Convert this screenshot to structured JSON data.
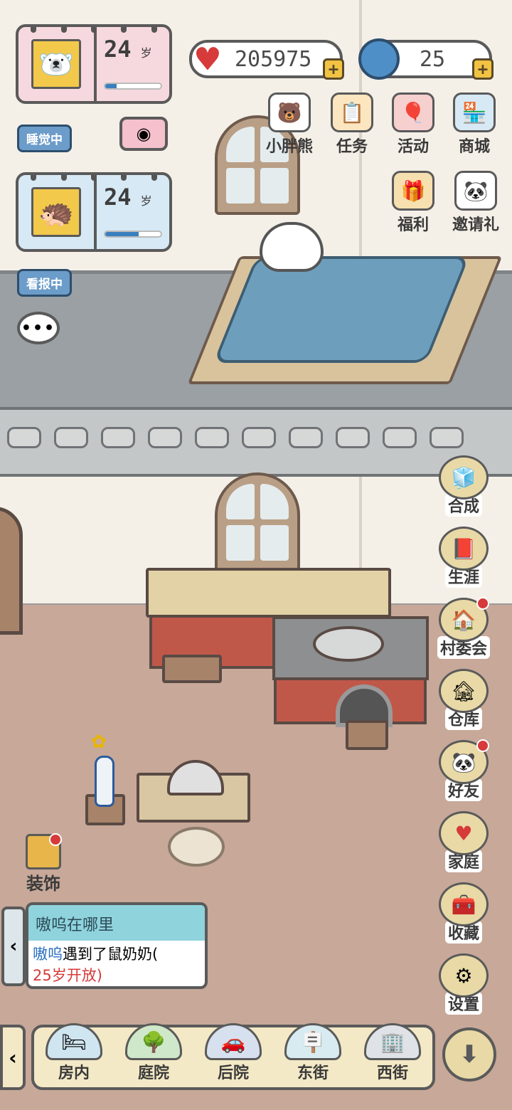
{
  "profile_cards": [
    {
      "age": "24",
      "unit": "岁",
      "progress": 0.2,
      "avatar_icon": "polar-bear-icon"
    },
    {
      "age": "24",
      "unit": "岁",
      "progress": 0.6,
      "avatar_icon": "hedgehog-icon"
    }
  ],
  "status": {
    "sleeping": "睡觉中",
    "reading": "看报中"
  },
  "currency": {
    "hearts": "205975",
    "gems": "25"
  },
  "top_menu": [
    {
      "label": "小胖熊",
      "icon": "bear-icon"
    },
    {
      "label": "任务",
      "icon": "task-board-icon"
    },
    {
      "label": "活动",
      "icon": "balloon-icon"
    },
    {
      "label": "商城",
      "icon": "shop-icon"
    },
    {
      "label": "福利",
      "icon": "gift-bag-icon"
    },
    {
      "label": "邀请礼",
      "icon": "panda-icon"
    }
  ],
  "side_menu": [
    {
      "label": "合成",
      "icon": "blocks-icon",
      "dot": false
    },
    {
      "label": "生涯",
      "icon": "book-icon",
      "dot": false
    },
    {
      "label": "村委会",
      "icon": "house-icon",
      "dot": true
    },
    {
      "label": "仓库",
      "icon": "warehouse-icon",
      "dot": false
    },
    {
      "label": "好友",
      "icon": "panda-friends-icon",
      "dot": true
    },
    {
      "label": "家庭",
      "icon": "hearts-icon",
      "dot": false
    },
    {
      "label": "收藏",
      "icon": "treasure-chest-icon",
      "dot": false
    },
    {
      "label": "设置",
      "icon": "gear-icon",
      "dot": false
    }
  ],
  "decorate": {
    "label": "装饰"
  },
  "notice": {
    "title": "嗷呜在哪里",
    "name": "嗷呜",
    "text": "遇到了鼠奶奶(",
    "red": "25岁开放)"
  },
  "bottom_tabs": [
    {
      "label": "房内",
      "icon": "bed-icon"
    },
    {
      "label": "庭院",
      "icon": "garden-icon"
    },
    {
      "label": "后院",
      "icon": "car-icon"
    },
    {
      "label": "东街",
      "icon": "street-sign-icon"
    },
    {
      "label": "西街",
      "icon": "building-icon"
    }
  ]
}
